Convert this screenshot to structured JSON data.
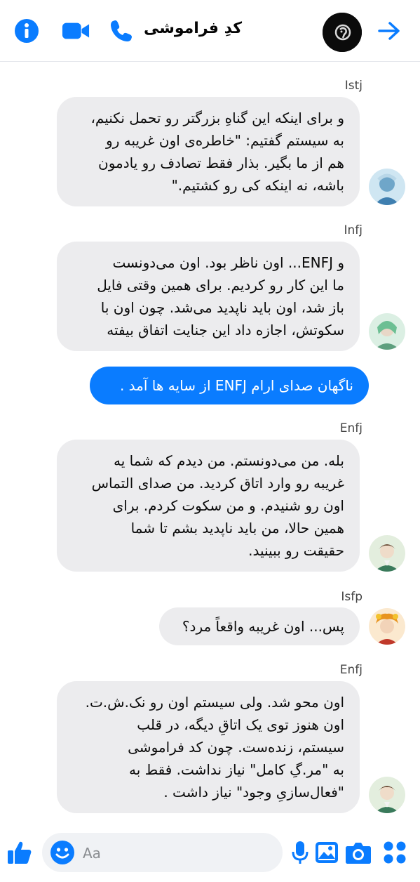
{
  "header": {
    "title": "کدِ فراموشی"
  },
  "messages": [
    {
      "sender": "Istj",
      "text": "و برای اینکه این گناهِ بزرگتر رو تحمل نکنیم،\nبه سیستم گفتیم: \"خاطره‌ی اون غریبه رو\nهم از ما بگیر. بذار فقط تصادف رو یادمون\nباشه، نه اینکه کی رو کشتیم.\""
    },
    {
      "sender": "Infj",
      "text": "و ENFJ... اون ناظر بود. اون می‌دونست\nما این کار رو کردیم. برای همین وقتی فایل\nباز شد، اون باید ناپدید می‌شد. چون اون با\nسکوتش، اجازه داد این جنایت اتفاق بیفته"
    },
    {
      "sender": "",
      "text": "ناگهان صدای ارام ENFJ از سایه ها آمد ."
    },
    {
      "sender": "Enfj",
      "text": "بله. من می‌دونستم. من دیدم که شما یه\nغریبه رو وارد اتاق کردید. من صدای التماس\nاون رو شنیدم. و من سکوت کردم. برای\nهمین حالا، من باید ناپدید بشم تا شما\nحقیقت رو ببینید."
    },
    {
      "sender": "Isfp",
      "text": "پس... اون غریبه واقعاً مرد؟"
    },
    {
      "sender": "Enfj",
      "text": "اون محو شد. ولی سیستم اون رو نک.ش.ت.\nاون هنوز توی یک اتاقِ دیگه، در قلب\nسیستم، زنده‌ست. چون کد فراموشی\nبه \"مر.گِ کامل\" نیاز نداشت. فقط به\n\"فعال‌سازیِ وجود\" نیاز داشت ."
    }
  ],
  "composer": {
    "placeholder": "Aa"
  },
  "colors": {
    "accent": "#0a7cff",
    "bubble_gray": "#ececee"
  }
}
